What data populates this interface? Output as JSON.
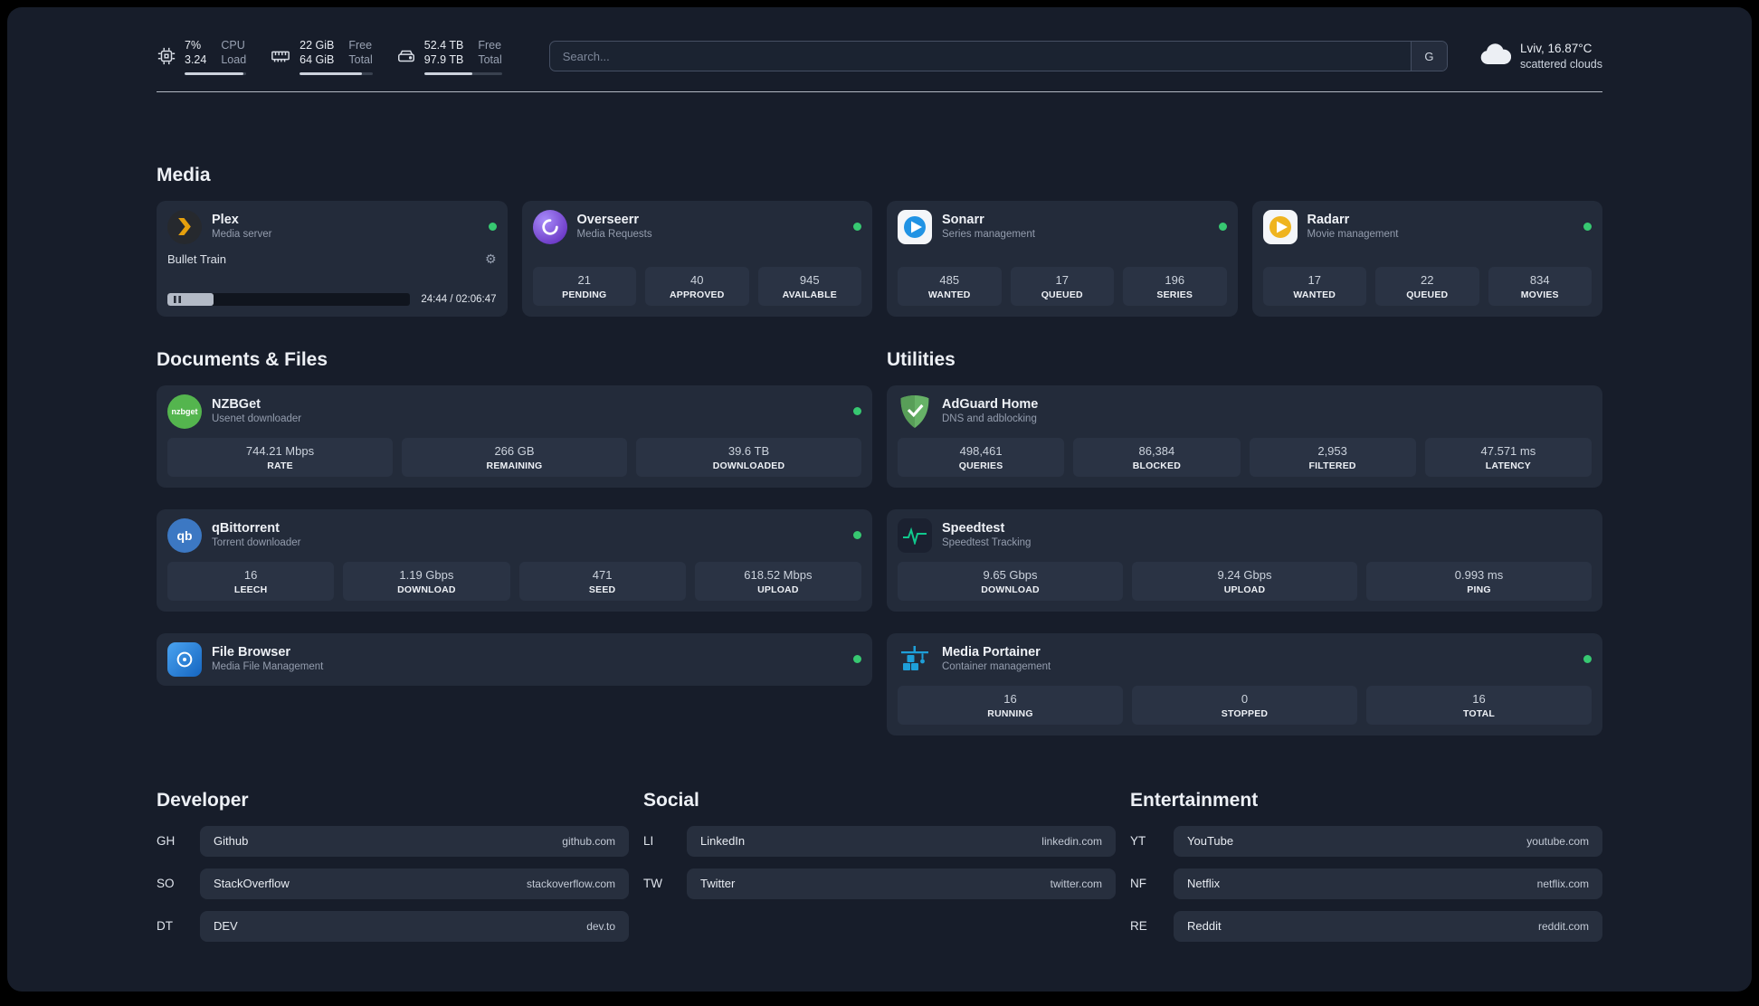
{
  "topbar": {
    "cpu": {
      "v1": "7%",
      "v2": "3.24",
      "l1": "CPU",
      "l2": "Load",
      "bar": 96
    },
    "ram": {
      "v1": "22 GiB",
      "v2": "64 GiB",
      "l1": "Free",
      "l2": "Total",
      "bar": 86
    },
    "disk": {
      "v1": "52.4 TB",
      "v2": "97.9 TB",
      "l1": "Free",
      "l2": "Total",
      "bar": 62
    },
    "search": {
      "placeholder": "Search...",
      "button_label": "G"
    },
    "weather": {
      "location": "Lviv, 16.87°C",
      "condition": "scattered clouds"
    }
  },
  "media": {
    "title": "Media",
    "plex": {
      "name": "Plex",
      "subtitle": "Media server",
      "now_playing": "Bullet Train",
      "time": "24:44 / 02:06:47",
      "progress_percent": 19
    },
    "overseerr": {
      "name": "Overseerr",
      "subtitle": "Media Requests",
      "stats": [
        {
          "value": "21",
          "label": "PENDING"
        },
        {
          "value": "40",
          "label": "APPROVED"
        },
        {
          "value": "945",
          "label": "AVAILABLE"
        }
      ]
    },
    "sonarr": {
      "name": "Sonarr",
      "subtitle": "Series management",
      "stats": [
        {
          "value": "485",
          "label": "WANTED"
        },
        {
          "value": "17",
          "label": "QUEUED"
        },
        {
          "value": "196",
          "label": "SERIES"
        }
      ]
    },
    "radarr": {
      "name": "Radarr",
      "subtitle": "Movie management",
      "stats": [
        {
          "value": "17",
          "label": "WANTED"
        },
        {
          "value": "22",
          "label": "QUEUED"
        },
        {
          "value": "834",
          "label": "MOVIES"
        }
      ]
    }
  },
  "documents": {
    "title": "Documents & Files",
    "nzbget": {
      "name": "NZBGet",
      "subtitle": "Usenet downloader",
      "stats": [
        {
          "value": "744.21 Mbps",
          "label": "RATE"
        },
        {
          "value": "266 GB",
          "label": "REMAINING"
        },
        {
          "value": "39.6 TB",
          "label": "DOWNLOADED"
        }
      ]
    },
    "qbittorrent": {
      "name": "qBittorrent",
      "subtitle": "Torrent downloader",
      "stats": [
        {
          "value": "16",
          "label": "LEECH"
        },
        {
          "value": "1.19 Gbps",
          "label": "DOWNLOAD"
        },
        {
          "value": "471",
          "label": "SEED"
        },
        {
          "value": "618.52 Mbps",
          "label": "UPLOAD"
        }
      ]
    },
    "filebrowser": {
      "name": "File Browser",
      "subtitle": "Media File Management"
    }
  },
  "utilities": {
    "title": "Utilities",
    "adguard": {
      "name": "AdGuard Home",
      "subtitle": "DNS and adblocking",
      "stats": [
        {
          "value": "498,461",
          "label": "QUERIES"
        },
        {
          "value": "86,384",
          "label": "BLOCKED"
        },
        {
          "value": "2,953",
          "label": "FILTERED"
        },
        {
          "value": "47.571 ms",
          "label": "LATENCY"
        }
      ]
    },
    "speedtest": {
      "name": "Speedtest",
      "subtitle": "Speedtest Tracking",
      "stats": [
        {
          "value": "9.65 Gbps",
          "label": "DOWNLOAD"
        },
        {
          "value": "9.24 Gbps",
          "label": "UPLOAD"
        },
        {
          "value": "0.993 ms",
          "label": "PING"
        }
      ]
    },
    "portainer": {
      "name": "Media Portainer",
      "subtitle": "Container management",
      "stats": [
        {
          "value": "16",
          "label": "RUNNING"
        },
        {
          "value": "0",
          "label": "STOPPED"
        },
        {
          "value": "16",
          "label": "TOTAL"
        }
      ]
    }
  },
  "bookmarks": {
    "developer": {
      "title": "Developer",
      "items": [
        {
          "abbr": "GH",
          "name": "Github",
          "url": "github.com"
        },
        {
          "abbr": "SO",
          "name": "StackOverflow",
          "url": "stackoverflow.com"
        },
        {
          "abbr": "DT",
          "name": "DEV",
          "url": "dev.to"
        }
      ]
    },
    "social": {
      "title": "Social",
      "items": [
        {
          "abbr": "LI",
          "name": "LinkedIn",
          "url": "linkedin.com"
        },
        {
          "abbr": "TW",
          "name": "Twitter",
          "url": "twitter.com"
        }
      ]
    },
    "entertainment": {
      "title": "Entertainment",
      "items": [
        {
          "abbr": "YT",
          "name": "YouTube",
          "url": "youtube.com"
        },
        {
          "abbr": "NF",
          "name": "Netflix",
          "url": "netflix.com"
        },
        {
          "abbr": "RE",
          "name": "Reddit",
          "url": "reddit.com"
        }
      ]
    }
  }
}
